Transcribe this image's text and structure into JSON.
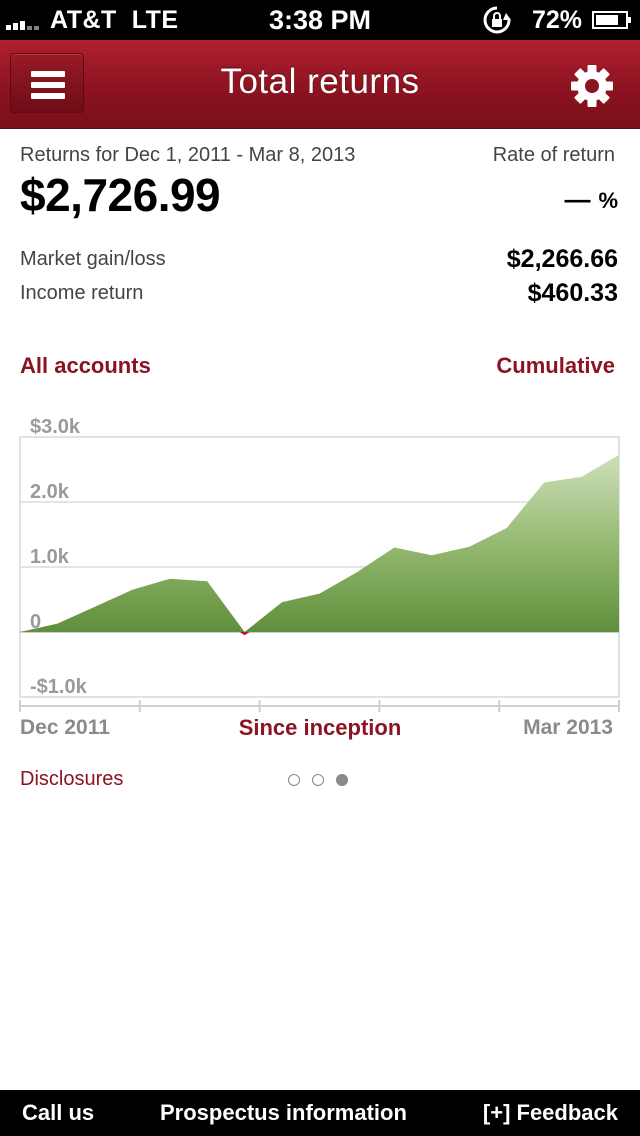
{
  "status_bar": {
    "carrier": "AT&T",
    "network": "LTE",
    "time": "3:38 PM",
    "battery_percent": "72%"
  },
  "header": {
    "title": "Total returns",
    "menu_icon": "menu-icon",
    "settings_icon": "gear-icon"
  },
  "summary": {
    "period": "Returns for Dec 1, 2011 - Mar 8, 2013",
    "total": "$2,726.99",
    "rate_label": "Rate of return",
    "rate_value": "—",
    "rate_unit": "%",
    "rows": [
      {
        "label": "Market gain/loss",
        "value": "$2,266.66"
      },
      {
        "label": "Income return",
        "value": "$460.33"
      }
    ]
  },
  "filters": {
    "accounts": "All accounts",
    "mode": "Cumulative"
  },
  "chart_data": {
    "type": "area",
    "x_start_label": "Dec 2011",
    "x_end_label": "Mar 2013",
    "y_tick_labels": [
      "$3.0k",
      "2.0k",
      "1.0k",
      "0",
      "-$1.0k"
    ],
    "y_ticks": [
      3000,
      2000,
      1000,
      0,
      -1000
    ],
    "ylim": [
      -1000,
      3000
    ],
    "values": [
      0,
      130,
      390,
      650,
      820,
      780,
      -50,
      460,
      590,
      920,
      1300,
      1180,
      1310,
      1600,
      2300,
      2390,
      2727
    ],
    "fill_color": "#6b9a45",
    "negative_marker_color": "#c8102e",
    "grid": true
  },
  "period_range": "Since inception",
  "disclosures": "Disclosures",
  "pager": {
    "count": 3,
    "active": 2
  },
  "toolbar": {
    "call": "Call us",
    "prospectus": "Prospectus information",
    "feedback": "[+] Feedback"
  },
  "colors": {
    "brand": "#8b1422",
    "nav_bar": "#9a1826"
  }
}
